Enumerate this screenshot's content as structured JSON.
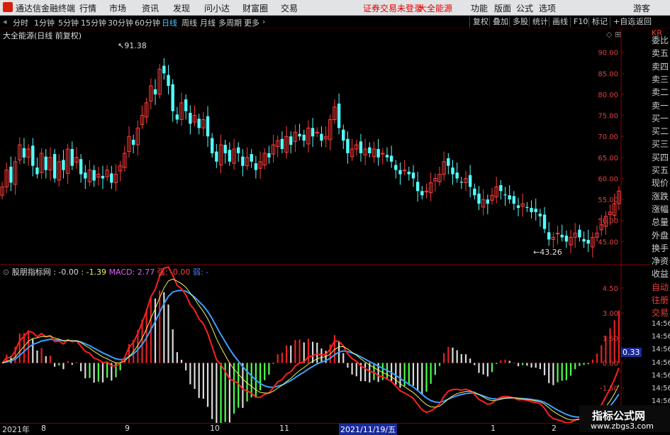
{
  "app": {
    "title": "通达信金融终端",
    "menu": [
      "行情",
      "市场",
      "资讯",
      "发现",
      "问小达",
      "财富圈",
      "交易"
    ],
    "notice": "证券交易未登录",
    "stock_name": "大全能源",
    "right_menu": [
      "功能",
      "版面",
      "公式",
      "选项"
    ],
    "user": "游客"
  },
  "period_bar": {
    "items": [
      "分时",
      "1分钟",
      "5分钟",
      "15分钟",
      "30分钟",
      "60分钟",
      "日线",
      "周线",
      "月线",
      "多周期",
      "更多"
    ],
    "active": "日线",
    "right_buttons": [
      "复权",
      "叠加",
      "多股",
      "统计",
      "画线",
      "F10",
      "标记",
      "+自选",
      "返回"
    ]
  },
  "main_chart": {
    "label": "大全能源(日线 前复权)",
    "high_label": "91.38",
    "low_label": "43.26"
  },
  "indicator": {
    "name": "股朋指标网",
    "v1": ": -0.00",
    "v2": ": -1.39",
    "macd_label": "MACD: 2.77",
    "strong_label": "强: -0.00",
    "weak_label": "弱: -",
    "current_value": "0.33"
  },
  "date_bar": {
    "labels": [
      "2021年",
      "8",
      "9",
      "10",
      "11",
      "1",
      "2"
    ],
    "selected_date": "2021/11/19/五"
  },
  "side_panel": {
    "code": "KR",
    "items": [
      "委比",
      "卖五",
      "卖四",
      "卖三",
      "卖二",
      "卖一",
      "买一",
      "买二",
      "买三",
      "买四",
      "买五",
      "现价",
      "涨跌",
      "涨幅",
      "总量",
      "外盘",
      "换手",
      "净资",
      "收益",
      "自动",
      "往册",
      "交易",
      "14:56",
      "14:56",
      "14:56",
      "14:56",
      "14:56",
      "14:56",
      "14:56",
      "14:56",
      "14:56"
    ]
  },
  "watermark": {
    "line1": "指标公式网",
    "line2": "www.zbgs3.com"
  },
  "colors": {
    "up": "#ff3c3c",
    "down": "#54ffff",
    "macd_pos": "#e42222",
    "macd_neg": "#4cff4c",
    "dif": "#ff2020",
    "dea": "#3aa0ff",
    "ma": "#f0f060"
  },
  "chart_data": [
    {
      "type": "candlestick",
      "title": "大全能源(日线 前复权)",
      "y_axis_ticks": [
        "90.00",
        "85.00",
        "80.00",
        "75.00",
        "70.00",
        "65.00",
        "60.00",
        "55.00",
        "50.00",
        "45.00"
      ],
      "ylim": [
        40,
        94
      ],
      "close": [
        58.0,
        62.0,
        59.0,
        64.0,
        68.0,
        65.0,
        67.0,
        63.0,
        61.0,
        66.0,
        62.0,
        65.0,
        60.0,
        64.0,
        62.0,
        67.0,
        63.0,
        65.0,
        61.0,
        60.0,
        62.0,
        59.5,
        61.0,
        60.0,
        62.0,
        59.0,
        61.0,
        63.0,
        66.0,
        70.0,
        68.0,
        72.0,
        75.0,
        78.0,
        82.0,
        80.0,
        86.0,
        85.0,
        82.0,
        76.0,
        74.0,
        78.0,
        76.0,
        73.0,
        75.0,
        72.0,
        74.0,
        70.0,
        66.0,
        64.0,
        68.0,
        66.0,
        64.0,
        67.0,
        66.0,
        63.0,
        65.0,
        64.0,
        62.0,
        64.0,
        66.0,
        65.0,
        68.0,
        69.0,
        67.0,
        70.0,
        68.0,
        71.0,
        70.0,
        69.0,
        72.0,
        70.0,
        71.0,
        69.0,
        70.0,
        74.0,
        77.0,
        72.0,
        69.0,
        66.0,
        67.0,
        68.0,
        66.0,
        67.0,
        66.0,
        67.0,
        65.0,
        66.0,
        65.0,
        64.0,
        62.0,
        61.0,
        62.0,
        61.0,
        60.0,
        57.0,
        56.0,
        57.0,
        59.0,
        60.0,
        61.0,
        64.0,
        63.0,
        61.0,
        60.0,
        59.0,
        60.0,
        58.0,
        56.0,
        54.0,
        55.0,
        54.0,
        56.0,
        58.0,
        57.0,
        56.0,
        55.0,
        54.0,
        53.0,
        54.0,
        53.0,
        52.0,
        52.0,
        51.0,
        48.0,
        45.5,
        46.0,
        47.0,
        46.0,
        45.0,
        46.0,
        47.0,
        46.0,
        45.0,
        44.5,
        46.0,
        47.0,
        49.0,
        51.0,
        52.0,
        54.0,
        57.0
      ]
    },
    {
      "type": "bar",
      "title": "MACD",
      "y_axis_ticks": [
        "4.50",
        "3.00",
        "1.50",
        "0.00",
        "-1.50",
        "-3.00"
      ],
      "ylim": [
        -3.6,
        5.6
      ]
    }
  ]
}
